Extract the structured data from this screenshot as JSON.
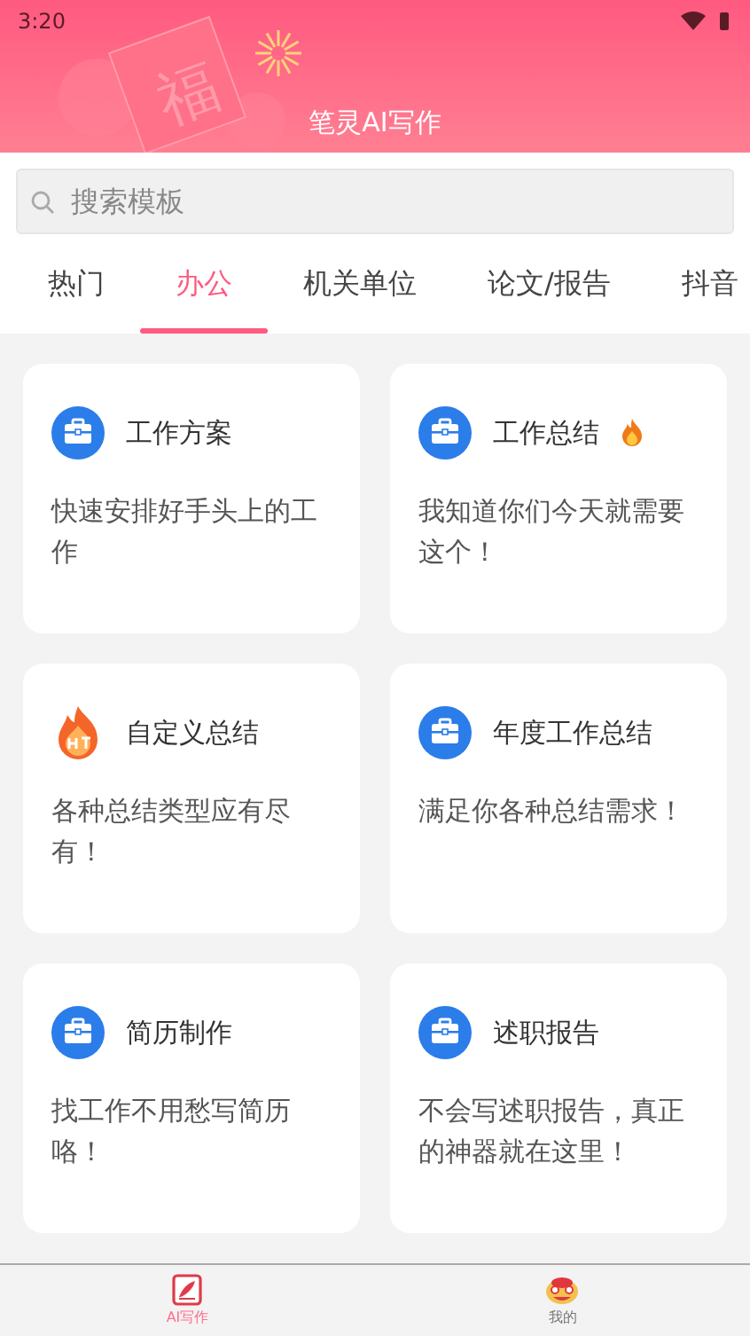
{
  "status_bar": {
    "time": "3:20"
  },
  "header": {
    "title": "笔灵AI写作",
    "ornament_char": "福"
  },
  "search": {
    "placeholder": "搜索模板"
  },
  "tabs": [
    {
      "label": "热门",
      "selected": false
    },
    {
      "label": "办公",
      "selected": true
    },
    {
      "label": "机关单位",
      "selected": false
    },
    {
      "label": "论文/报告",
      "selected": false
    },
    {
      "label": "抖音",
      "selected": false
    }
  ],
  "cards": [
    {
      "kind": "briefcase",
      "title": "工作方案",
      "hot": false,
      "description": "快速安排好手头上的工作"
    },
    {
      "kind": "briefcase",
      "title": "工作总结",
      "hot": true,
      "description": "我知道你们今天就需要这个！"
    },
    {
      "kind": "flame",
      "title": "自定义总结",
      "hot": false,
      "description": "各种总结类型应有尽有！"
    },
    {
      "kind": "briefcase",
      "title": "年度工作总结",
      "hot": false,
      "description": "满足你各种总结需求！"
    },
    {
      "kind": "briefcase",
      "title": "简历制作",
      "hot": false,
      "description": "找工作不用愁写简历咯！"
    },
    {
      "kind": "briefcase",
      "title": "述职报告",
      "hot": false,
      "description": "不会写述职报告，真正的神器就在这里！"
    }
  ],
  "bottom_nav": [
    {
      "label": "AI写作",
      "selected": true
    },
    {
      "label": "我的",
      "selected": false
    }
  ]
}
